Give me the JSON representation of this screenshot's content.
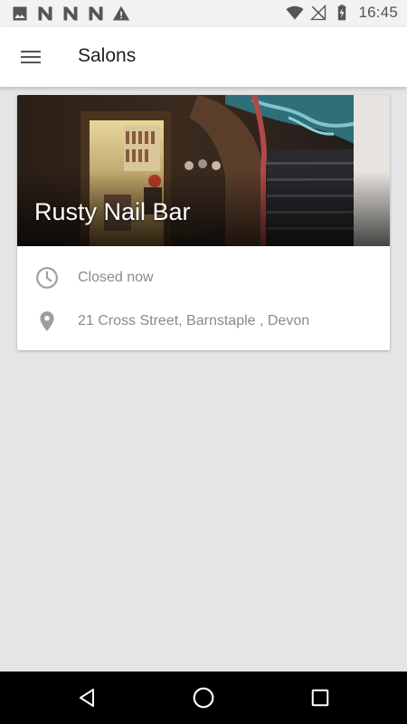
{
  "status_bar": {
    "time": "16:45",
    "left_icons": [
      "image-icon",
      "n-notification-icon",
      "n-notification-icon",
      "n-notification-icon",
      "warning-icon"
    ],
    "right_icons": [
      "wifi-icon",
      "no-signal-icon",
      "battery-charging-icon"
    ]
  },
  "app_bar": {
    "menu_icon": "menu-icon",
    "title": "Salons"
  },
  "salon_card": {
    "name": "Rusty Nail Bar",
    "hours_status": "Closed now",
    "hours_icon": "clock-icon",
    "address": "21 Cross Street, Barnstaple , Devon",
    "address_icon": "location-pin-icon"
  },
  "nav_bar": {
    "icons": [
      "back-icon",
      "home-icon",
      "recents-icon"
    ]
  },
  "colors": {
    "background": "#e5e5e5",
    "app_bar": "#ffffff",
    "card": "#ffffff",
    "secondary_text": "#8a8a8a",
    "icon_grey": "#9e9e9e",
    "nav_bar": "#000000"
  }
}
